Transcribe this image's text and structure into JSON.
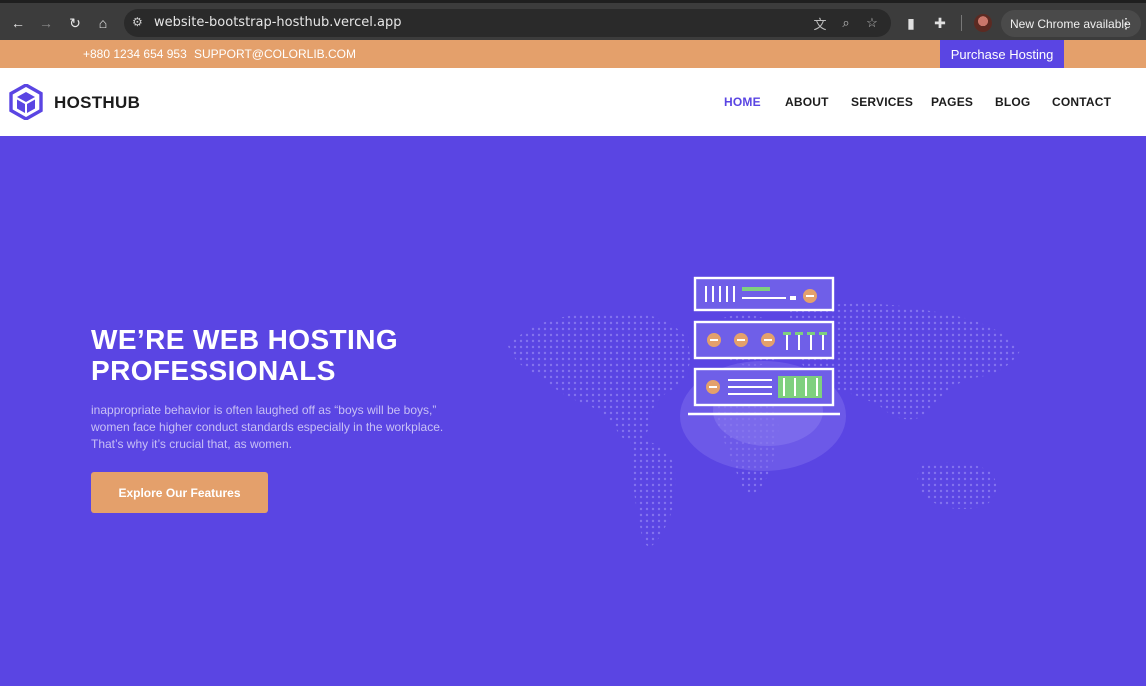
{
  "browser": {
    "url": "website-bootstrap-hosthub.vercel.app",
    "update_label": "New Chrome available",
    "icons": [
      "back-arrow-icon",
      "forward-arrow-icon",
      "reload-icon",
      "home-icon",
      "site-settings-icon",
      "translate-icon",
      "zoom-icon",
      "bookmark-star-icon",
      "extension-icon",
      "puzzle-icon",
      "profile-avatar",
      "more-vert-icon"
    ]
  },
  "topbar": {
    "phone": "+880 1234 654 953",
    "email": "SUPPORT@COLORLIB.COM",
    "purchase_label": "Purchase Hosting"
  },
  "header": {
    "brand": "HOSTHUB",
    "nav": [
      {
        "label": "HOME",
        "active": true
      },
      {
        "label": "ABOUT",
        "active": false
      },
      {
        "label": "SERVICES",
        "active": false
      },
      {
        "label": "PAGES",
        "active": false
      },
      {
        "label": "BLOG",
        "active": false
      },
      {
        "label": "CONTACT",
        "active": false
      }
    ]
  },
  "hero": {
    "title": "WE’RE WEB HOSTING PROFESSIONALS",
    "body": "inappropriate behavior is often laughed off as “boys will be boys,” women face higher conduct standards especially in the workplace. That’s why it’s crucial that, as women.",
    "cta_label": "Explore Our Features"
  },
  "colors": {
    "primary": "#5a45e3",
    "accent": "#e4a06b",
    "text_dark": "#1c1c1c",
    "white": "#ffffff"
  }
}
